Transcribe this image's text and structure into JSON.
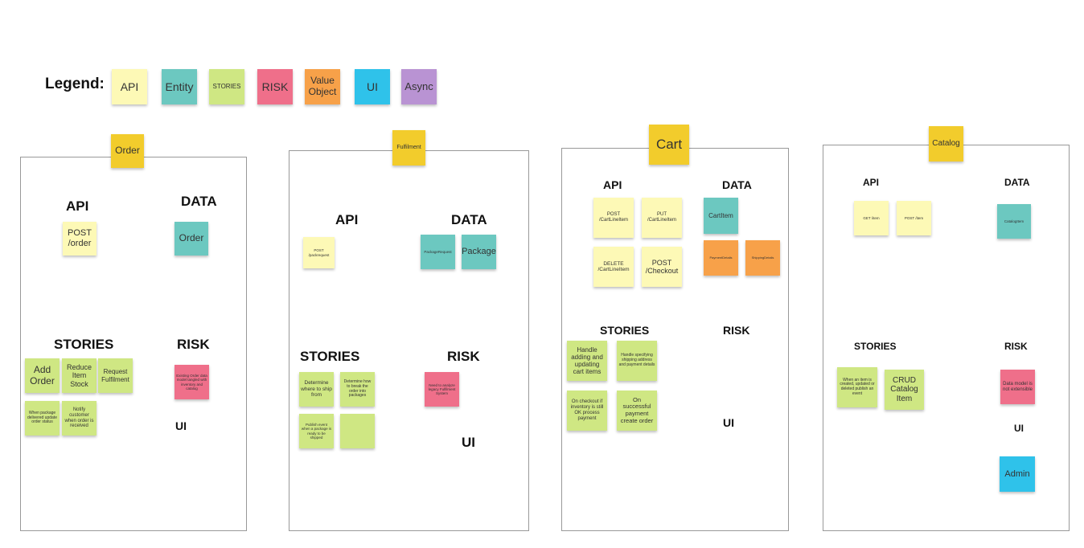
{
  "legend": {
    "title": "Legend:",
    "items": [
      "API",
      "Entity",
      "STORIES",
      "RISK",
      "Value Object",
      "UI",
      "Async"
    ]
  },
  "colors": {
    "api": "#fdf9b6",
    "entity": "#6cc8c0",
    "stories": "#cfe783",
    "risk": "#ef6f8a",
    "value_object": "#f7a149",
    "ui": "#2fc2ea",
    "async": "#b993d3",
    "title": "#f2cc2c"
  },
  "boards": {
    "order": {
      "title": "Order",
      "api_h": "API",
      "data_h": "DATA",
      "stories_h": "STORIES",
      "risk_h": "RISK",
      "ui_h": "UI",
      "api": [
        "POST /order"
      ],
      "data": [
        "Order"
      ],
      "stories": [
        "Add Order",
        "Reduce Item Stock",
        "Request Fulfilment",
        "When package delivered update order status",
        "Notify customer when order is received"
      ],
      "risk": [
        "Existing Order data model tangled with inventory and catalog"
      ]
    },
    "fulfilment": {
      "title": "Fulfilment",
      "api_h": "API",
      "data_h": "DATA",
      "stories_h": "STORIES",
      "risk_h": "RISK",
      "ui_h": "UI",
      "api": [
        "POST /packrequest"
      ],
      "data": [
        "PackageRequest",
        "Package"
      ],
      "stories": [
        "Determine where to ship from",
        "Determine how to break the order into packages",
        "Publish event when a package is ready to be shipped",
        ""
      ],
      "risk": [
        "Need to analyze legacy Fulfilment System"
      ]
    },
    "cart": {
      "title": "Cart",
      "api_h": "API",
      "data_h": "DATA",
      "stories_h": "STORIES",
      "risk_h": "RISK",
      "ui_h": "UI",
      "api": [
        "POST /CartLineItem",
        "PUT /CartLineItem",
        "DELETE /CartLineItem",
        "POST /Checkout"
      ],
      "data": [
        "CartItem",
        "PaymentDetails",
        "ShippingDetails"
      ],
      "stories": [
        "Handle adding and updating cart items",
        "Handle specifying shipping address and payment details",
        "On checkout if inventory is still OK process payment",
        "On successful payment create order"
      ]
    },
    "catalog": {
      "title": "Catalog",
      "api_h": "API",
      "data_h": "DATA",
      "stories_h": "STORIES",
      "risk_h": "RISK",
      "ui_h": "UI",
      "api": [
        "GET /item",
        "POST /item"
      ],
      "data": [
        "CatalogItem"
      ],
      "stories": [
        "When an item is created, updated or deleted publish an event",
        "CRUD Catalog Item"
      ],
      "risk": [
        "Data model is not extensible"
      ],
      "ui": [
        "Admin"
      ]
    }
  }
}
